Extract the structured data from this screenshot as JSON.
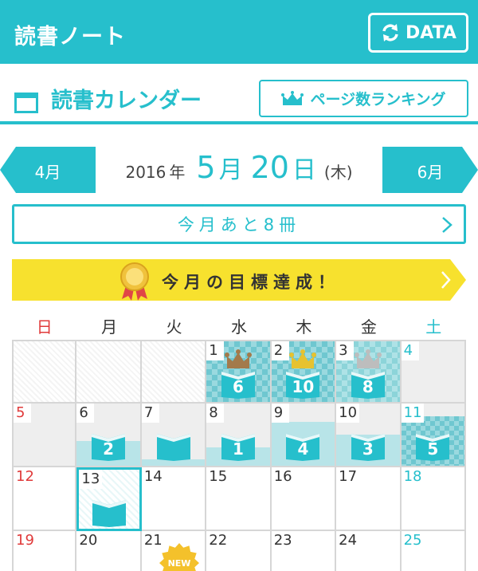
{
  "header": {
    "title": "読書ノート",
    "data_button": "DATA"
  },
  "subheader": {
    "title": "読書カレンダー",
    "ranking_button": "ページ数ランキング"
  },
  "month_nav": {
    "prev": "4月",
    "next": "6月",
    "year": "2016",
    "year_suffix": "年",
    "month": "5",
    "month_suffix": "月",
    "day": "20",
    "day_suffix": "日",
    "weekday": "(木)"
  },
  "remaining": {
    "label": "今月あと8冊"
  },
  "goal": {
    "label": "今月の目標達成！"
  },
  "weekdays": [
    "日",
    "月",
    "火",
    "水",
    "木",
    "金",
    "土"
  ],
  "colors": {
    "accent": "#26bfcc",
    "sunday": "#e03a3a",
    "goal_banner": "#f7e12e",
    "crown_bronze": "#a37a4b",
    "crown_gold": "#e6c230",
    "crown_silver": "#bdbdbd"
  },
  "calendar": {
    "weeks": [
      [
        {
          "day": "",
          "style": "empty"
        },
        {
          "day": "",
          "style": "empty"
        },
        {
          "day": "",
          "style": "empty"
        },
        {
          "day": "1",
          "style": "check",
          "books": "6",
          "crown": "bronze"
        },
        {
          "day": "2",
          "style": "check",
          "books": "10",
          "crown": "gold"
        },
        {
          "day": "3",
          "style": "check2",
          "books": "8",
          "crown": "silver"
        },
        {
          "day": "4",
          "style": "gray"
        }
      ],
      [
        {
          "day": "5",
          "style": "gray"
        },
        {
          "day": "6",
          "style": "gray",
          "books": "2",
          "fill": 0.4
        },
        {
          "day": "7",
          "style": "gray",
          "books": "",
          "fill": 0.1
        },
        {
          "day": "8",
          "style": "gray",
          "books": "1",
          "fill": 0.3
        },
        {
          "day": "9",
          "style": "gray",
          "books": "4",
          "fill": 0.7
        },
        {
          "day": "10",
          "style": "gray",
          "books": "3",
          "fill": 0.5
        },
        {
          "day": "11",
          "style": "gray",
          "books": "5",
          "fill": 0.8,
          "patterned": true
        }
      ],
      [
        {
          "day": "12",
          "style": "plain"
        },
        {
          "day": "13",
          "style": "today",
          "books": ""
        },
        {
          "day": "14",
          "style": "plain"
        },
        {
          "day": "15",
          "style": "plain"
        },
        {
          "day": "16",
          "style": "plain"
        },
        {
          "day": "17",
          "style": "plain"
        },
        {
          "day": "18",
          "style": "plain"
        }
      ],
      [
        {
          "day": "19",
          "style": "plain"
        },
        {
          "day": "20",
          "style": "plain"
        },
        {
          "day": "21",
          "style": "plain",
          "badge": "NEW"
        },
        {
          "day": "22",
          "style": "plain"
        },
        {
          "day": "23",
          "style": "plain"
        },
        {
          "day": "24",
          "style": "plain"
        },
        {
          "day": "25",
          "style": "plain"
        }
      ]
    ]
  }
}
